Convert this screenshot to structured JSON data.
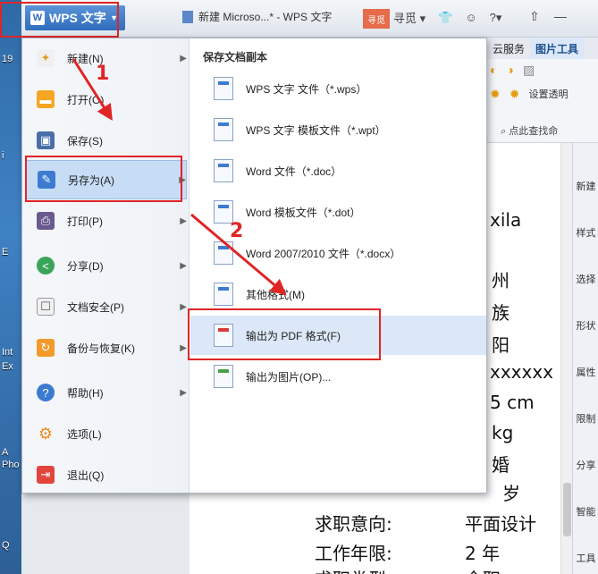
{
  "desktop": {
    "labels": [
      "19",
      "i",
      "E",
      "Int",
      "Ex",
      "A",
      "Pho",
      "Q"
    ]
  },
  "titlebar": {
    "app_button": "WPS 文字",
    "doc_tab": "新建 Microso...* - WPS 文字",
    "find_label": "寻觅",
    "find_menu": "寻觅",
    "help": "?"
  },
  "ribbon": {
    "tabs": [
      "云服务",
      "图片工具"
    ],
    "transparent_label": "设置透明",
    "search_label": "点此查找命"
  },
  "menu": {
    "left_items": [
      {
        "label": "新建(N)",
        "icon": "new-doc-icon",
        "has_sub": true
      },
      {
        "label": "打开(O)",
        "icon": "folder-icon",
        "has_sub": false
      },
      {
        "label": "保存(S)",
        "icon": "save-icon",
        "has_sub": false
      },
      {
        "label": "另存为(A)",
        "icon": "save-as-icon",
        "has_sub": true
      },
      {
        "label": "打印(P)",
        "icon": "printer-icon",
        "has_sub": true
      },
      {
        "label": "分享(D)",
        "icon": "share-icon",
        "has_sub": true
      },
      {
        "label": "文档安全(P)",
        "icon": "security-icon",
        "has_sub": true
      },
      {
        "label": "备份与恢复(K)",
        "icon": "backup-icon",
        "has_sub": true
      },
      {
        "label": "帮助(H)",
        "icon": "help-icon",
        "has_sub": true
      },
      {
        "label": "选项(L)",
        "icon": "gear-icon",
        "has_sub": false
      },
      {
        "label": "退出(Q)",
        "icon": "exit-icon",
        "has_sub": false
      }
    ],
    "right_header": "保存文档副本",
    "right_items": [
      "WPS 文字 文件（*.wps）",
      "WPS 文字 模板文件（*.wpt）",
      "Word 文件（*.doc）",
      "Word 模板文件（*.dot）",
      "Word 2007/2010 文件（*.docx）",
      "其他格式(M)",
      "输出为 PDF 格式(F)",
      "输出为图片(OP)..."
    ]
  },
  "document": {
    "lines": [
      "xila",
      "州",
      "族",
      "阳",
      "xxxxxx",
      "5 cm",
      "kg",
      "婚",
      "岁"
    ],
    "job_intent_label": "求职意向:",
    "job_intent_value": "平面设计",
    "work_years_label": "工作年限:",
    "work_years_value": "2  年",
    "cut_left": "求职类型",
    "cut_right": "全职"
  },
  "right_pane": {
    "items": [
      "新建",
      "样式",
      "选择",
      "形状",
      "属性",
      "限制",
      "分享",
      "智能",
      "工具"
    ]
  },
  "annotations": {
    "step1": "1",
    "step2": "2"
  },
  "colors": {
    "accent": "#2f6dbd",
    "annotation": "#e02525",
    "highlight": "#dce8f8"
  }
}
